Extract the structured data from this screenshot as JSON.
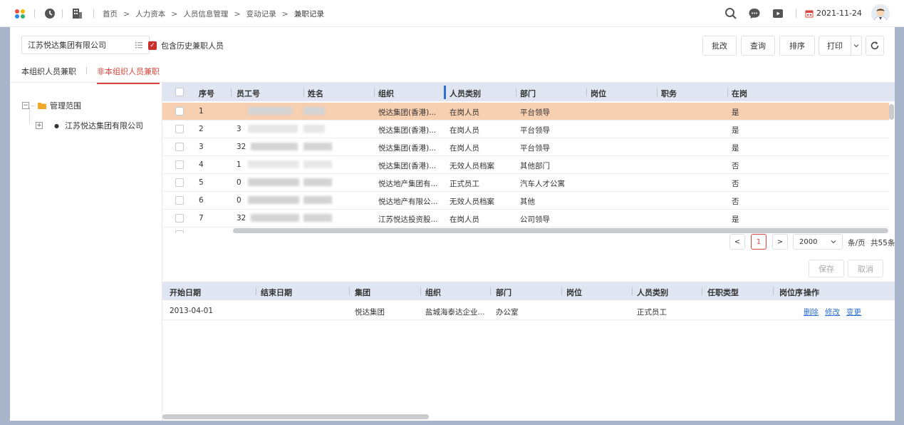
{
  "topbar": {
    "breadcrumbs": [
      "首页",
      "人力资本",
      "人员信息管理",
      "变动记录",
      "兼职记录"
    ],
    "date": "2021-11-24"
  },
  "toolbar": {
    "org_value": "江苏悦达集团有限公司",
    "include_history_label": "包含历史兼职人员",
    "include_history_checked": true,
    "btn_batch": "批改",
    "btn_query": "查询",
    "btn_sort": "排序",
    "btn_print": "打印"
  },
  "tabs": [
    {
      "label": "本组织人员兼职",
      "active": false
    },
    {
      "label": "非本组织人员兼职",
      "active": true
    }
  ],
  "tree": {
    "root_label": "管理范围",
    "child_label": "江苏悦达集团有限公司"
  },
  "table1": {
    "columns": [
      "序号",
      "员工号",
      "姓名",
      "组织",
      "人员类别",
      "部门",
      "岗位",
      "职务",
      "在岗"
    ],
    "rows": [
      {
        "no": "1",
        "id": "",
        "org": "悦达集团(香港)...",
        "category": "在岗人员",
        "dept": "平台领导",
        "post": "",
        "duty": "",
        "onduty": "是",
        "selected": true
      },
      {
        "no": "2",
        "id": "3",
        "org": "悦达集团(香港)...",
        "category": "在岗人员",
        "dept": "平台领导",
        "post": "",
        "duty": "",
        "onduty": "是",
        "selected": false
      },
      {
        "no": "3",
        "id": "32",
        "org": "悦达集团(香港)...",
        "category": "在岗人员",
        "dept": "平台领导",
        "post": "",
        "duty": "",
        "onduty": "是",
        "selected": false
      },
      {
        "no": "4",
        "id": "1",
        "org": "悦达集团(香港)...",
        "category": "无效人员档案",
        "dept": "其他部门",
        "post": "",
        "duty": "",
        "onduty": "否",
        "selected": false
      },
      {
        "no": "5",
        "id": "0",
        "org": "悦达地产集团有...",
        "category": "正式员工",
        "dept": "汽车人才公寓",
        "post": "",
        "duty": "",
        "onduty": "否",
        "selected": false
      },
      {
        "no": "6",
        "id": "0",
        "org": "悦达地产有限公...",
        "category": "无效人员档案",
        "dept": "其他",
        "post": "",
        "duty": "",
        "onduty": "否",
        "selected": false
      },
      {
        "no": "7",
        "id": "32",
        "org": "江苏悦达投资股...",
        "category": "在岗人员",
        "dept": "公司领导",
        "post": "",
        "duty": "",
        "onduty": "是",
        "selected": false
      }
    ]
  },
  "pager": {
    "prev": "<",
    "page": "1",
    "next": ">",
    "page_size": "2000",
    "per_page_label": "条/页",
    "total_label": "共55条"
  },
  "actions": {
    "save": "保存",
    "cancel": "取消"
  },
  "table2": {
    "columns": [
      "开始日期",
      "结束日期",
      "集团",
      "组织",
      "部门",
      "岗位",
      "人员类别",
      "任职类型",
      "岗位序",
      "操作"
    ],
    "rows": [
      {
        "start": "2013-04-01",
        "end": "",
        "group": "悦达集团",
        "org": "盐城海泰达企业...",
        "dept": "办公室",
        "post": "",
        "category": "正式员工",
        "type": "",
        "seq": "",
        "op_delete": "删除",
        "op_edit": "修改",
        "op_change": "变更"
      }
    ]
  },
  "colors": {
    "accent": "#d9453c",
    "selected_row": "#f7cfb1",
    "header_bg": "#dfe6f1",
    "link": "#2f6fd0"
  }
}
